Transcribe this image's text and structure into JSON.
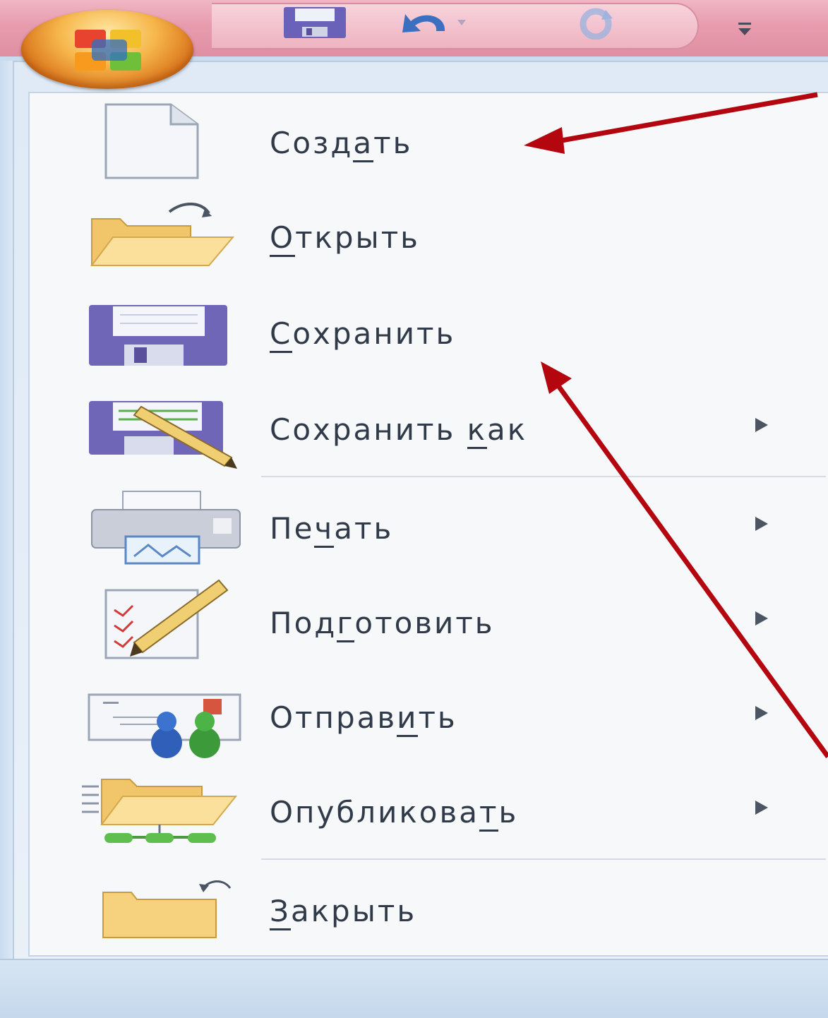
{
  "colors": {
    "titlebar": "#e79cae",
    "menu_bg": "#f7f8fa",
    "text": "#303a49",
    "annotation_arrow": "#b3060f"
  },
  "quick_access": {
    "buttons": [
      {
        "icon": "save-icon"
      },
      {
        "icon": "undo-icon"
      },
      {
        "icon": "redo-icon"
      },
      {
        "icon": "customize-dropdown-icon"
      }
    ]
  },
  "office_button": {
    "icon": "office-logo-icon"
  },
  "menu": {
    "items": [
      {
        "icon": "new-document-icon",
        "pre": "Созд",
        "key": "а",
        "post": "ть",
        "submenu": false
      },
      {
        "icon": "open-folder-icon",
        "pre": "",
        "key": "О",
        "post": "ткрыть",
        "submenu": false
      },
      {
        "icon": "save-icon",
        "pre": "",
        "key": "С",
        "post": "охранить",
        "submenu": false
      },
      {
        "icon": "save-as-icon",
        "pre": "Сохранить ",
        "key": "к",
        "post": "ак",
        "submenu": true
      },
      {
        "icon": "print-icon",
        "pre": "Пе",
        "key": "ч",
        "post": "ать",
        "submenu": true
      },
      {
        "icon": "prepare-icon",
        "pre": "Под",
        "key": "г",
        "post": "отовить",
        "submenu": true
      },
      {
        "icon": "send-icon",
        "pre": "Отправ",
        "key": "и",
        "post": "ть",
        "submenu": true
      },
      {
        "icon": "publish-icon",
        "pre": "Опубликова",
        "key": "т",
        "post": "ь",
        "submenu": true
      },
      {
        "icon": "close-folder-icon",
        "pre": "",
        "key": "З",
        "post": "акрыть",
        "submenu": false
      }
    ]
  }
}
